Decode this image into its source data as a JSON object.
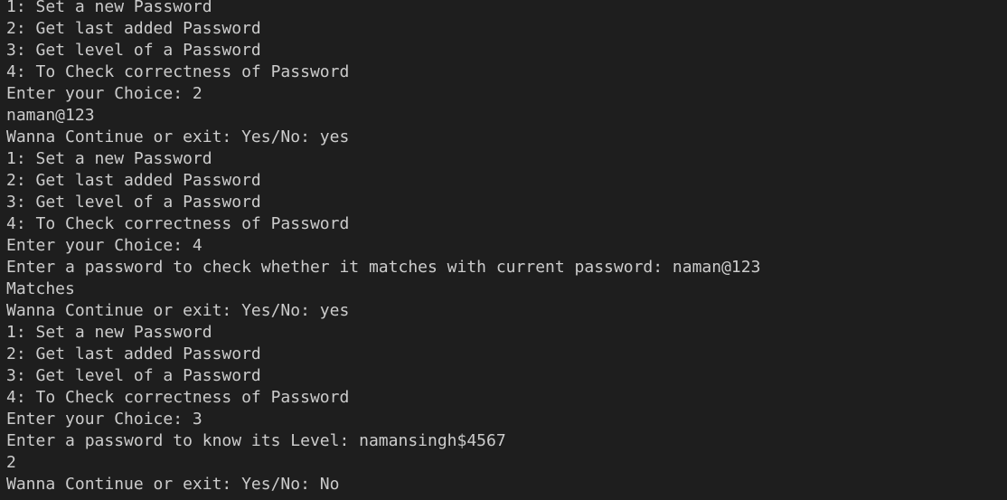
{
  "terminal": {
    "lines": [
      "1: Set a new Password",
      "2: Get last added Password",
      "3: Get level of a Password",
      "4: To Check correctness of Password",
      "Enter your Choice: 2",
      "naman@123",
      "Wanna Continue or exit: Yes/No: yes",
      "1: Set a new Password",
      "2: Get last added Password",
      "3: Get level of a Password",
      "4: To Check correctness of Password",
      "Enter your Choice: 4",
      "Enter a password to check whether it matches with current password: naman@123",
      "Matches",
      "Wanna Continue or exit: Yes/No: yes",
      "1: Set a new Password",
      "2: Get last added Password",
      "3: Get level of a Password",
      "4: To Check correctness of Password",
      "Enter your Choice: 3",
      "Enter a password to know its Level: namansingh$4567",
      "2",
      "Wanna Continue or exit: Yes/No: No"
    ],
    "colors": {
      "background": "#1e1e1e",
      "text": "#cccccc"
    }
  }
}
